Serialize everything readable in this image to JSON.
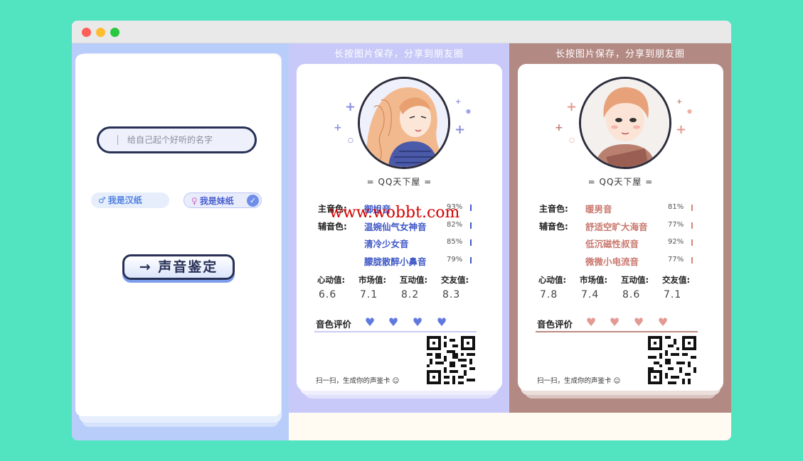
{
  "window": {
    "buttons": [
      "close",
      "minimize",
      "zoom"
    ]
  },
  "form": {
    "name_placeholder": "给自己起个好听的名字",
    "male_label": "我是汉纸",
    "female_label": "我是妹纸",
    "identify_label": "→ 声音鉴定"
  },
  "save_hint": "长按图片保存，分享到朋友圈",
  "cards": [
    {
      "theme": "female",
      "accent": "#3f58c7",
      "brand": "= QQ天下屋 =",
      "main_label": "主音色:",
      "aux_label": "辅音色:",
      "voices": [
        {
          "name": "御姐音",
          "pct": "93%"
        },
        {
          "name": "温婉仙气女神音",
          "pct": "82%"
        },
        {
          "name": "清冷少女音",
          "pct": "85%"
        },
        {
          "name": "朦胧散醉小鼻音",
          "pct": "79%"
        }
      ],
      "stats": [
        {
          "label": "心动值:",
          "value": "6.6"
        },
        {
          "label": "市场值:",
          "value": "7.1"
        },
        {
          "label": "互动值:",
          "value": "8.2"
        },
        {
          "label": "交友值:",
          "value": "8.3"
        }
      ],
      "rating_label": "音色评价",
      "scan_text": "扫一扫，生成你的声鉴卡 ☺"
    },
    {
      "theme": "male",
      "accent": "#c9786e",
      "brand": "= QQ天下屋 =",
      "main_label": "主音色:",
      "aux_label": "辅音色:",
      "voices": [
        {
          "name": "暖男音",
          "pct": "81%"
        },
        {
          "name": "舒适空旷大海音",
          "pct": "77%"
        },
        {
          "name": "低沉磁性叔音",
          "pct": "92%"
        },
        {
          "name": "微微小电流音",
          "pct": "77%"
        }
      ],
      "stats": [
        {
          "label": "心动值:",
          "value": "7.8"
        },
        {
          "label": "市场值:",
          "value": "7.4"
        },
        {
          "label": "互动值:",
          "value": "8.6"
        },
        {
          "label": "交友值:",
          "value": "7.1"
        }
      ],
      "rating_label": "音色评价",
      "scan_text": "扫一扫，生成你的声鉴卡 ☺"
    }
  ],
  "watermark": "www.wobbt.com"
}
